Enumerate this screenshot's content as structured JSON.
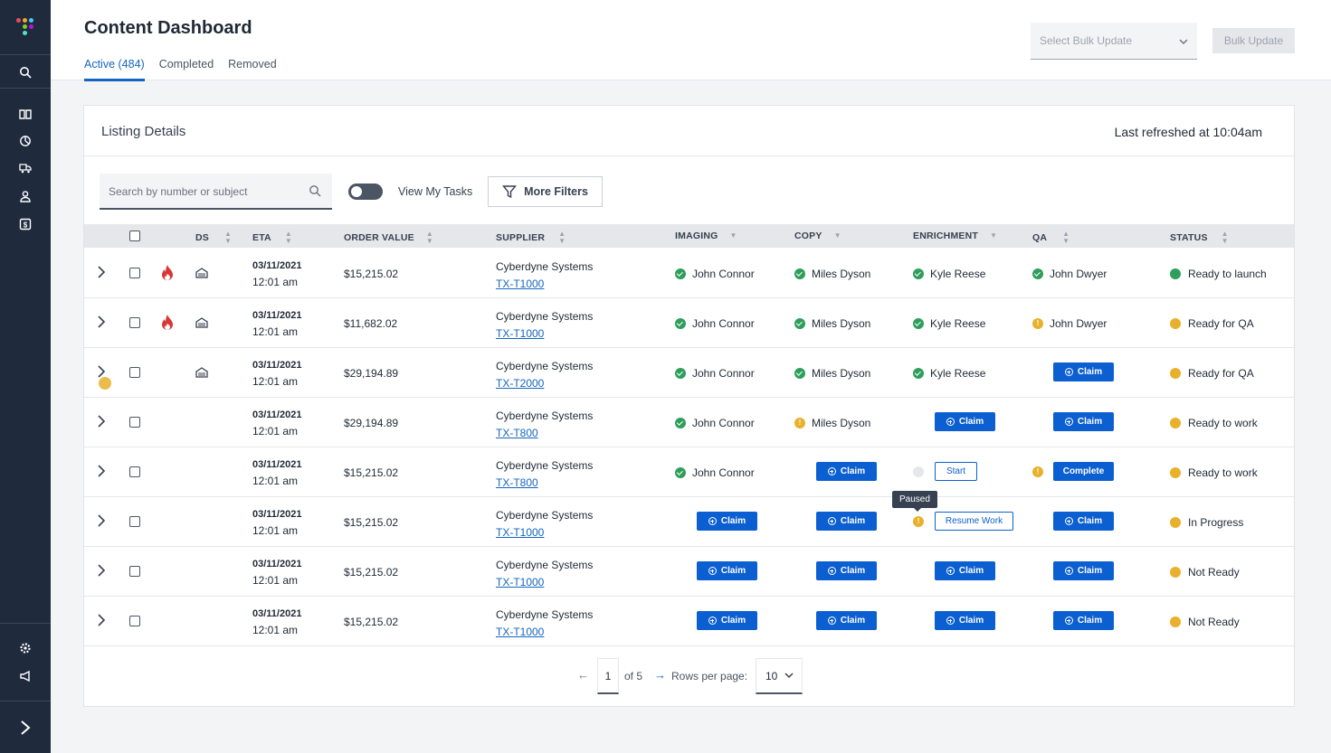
{
  "header": {
    "title": "Content Dashboard",
    "tabs": [
      {
        "label": "Active (484)",
        "active": true
      },
      {
        "label": "Completed",
        "active": false
      },
      {
        "label": "Removed",
        "active": false
      }
    ],
    "bulk_select_placeholder": "Select Bulk Update",
    "bulk_update_label": "Bulk Update"
  },
  "card": {
    "title": "Listing Details",
    "refreshed": "Last refreshed at 10:04am"
  },
  "toolbar": {
    "search_placeholder": "Search by number or subject",
    "toggle_label": "View My Tasks",
    "filters_label": "More Filters"
  },
  "columns": {
    "ds": "DS",
    "eta": "ETA",
    "order_value": "ORDER VALUE",
    "supplier": "SUPPLIER",
    "imaging": "IMAGING",
    "copy": "COPY",
    "enrichment": "ENRICHMENT",
    "qa": "QA",
    "status": "STATUS"
  },
  "labels": {
    "claim": "Claim",
    "start": "Start",
    "resume": "Resume Work",
    "complete": "Complete",
    "paused_tooltip": "Paused"
  },
  "rows": [
    {
      "eta_date": "03/11/2021",
      "eta_time": "12:01 am",
      "value": "$15,215.02",
      "supplier": "Cyberdyne Systems",
      "link": "TX-T1000",
      "imaging": "John Connor",
      "copy": "Miles Dyson",
      "enrichment": "Kyle Reese",
      "qa": "John Dwyer",
      "status": "Ready to launch"
    },
    {
      "eta_date": "03/11/2021",
      "eta_time": "12:01 am",
      "value": "$11,682.02",
      "supplier": "Cyberdyne Systems",
      "link": "TX-T1000",
      "imaging": "John Connor",
      "copy": "Miles Dyson",
      "enrichment": "Kyle Reese",
      "qa": "John Dwyer",
      "status": "Ready for QA"
    },
    {
      "eta_date": "03/11/2021",
      "eta_time": "12:01 am",
      "value": "$29,194.89",
      "supplier": "Cyberdyne Systems",
      "link": "TX-T2000",
      "imaging": "John Connor",
      "copy": "Miles Dyson",
      "enrichment": "Kyle Reese",
      "status": "Ready for QA"
    },
    {
      "eta_date": "03/11/2021",
      "eta_time": "12:01 am",
      "value": "$29,194.89",
      "supplier": "Cyberdyne Systems",
      "link": "TX-T800",
      "imaging": "John Connor",
      "copy": "Miles Dyson",
      "status": "Ready to work"
    },
    {
      "eta_date": "03/11/2021",
      "eta_time": "12:01 am",
      "value": "$15,215.02",
      "supplier": "Cyberdyne Systems",
      "link": "TX-T800",
      "imaging": "John Connor",
      "status": "Ready to work"
    },
    {
      "eta_date": "03/11/2021",
      "eta_time": "12:01 am",
      "value": "$15,215.02",
      "supplier": "Cyberdyne Systems",
      "link": "TX-T1000",
      "status": "In Progress"
    },
    {
      "eta_date": "03/11/2021",
      "eta_time": "12:01 am",
      "value": "$15,215.02",
      "supplier": "Cyberdyne Systems",
      "link": "TX-T1000",
      "status": "Not Ready"
    },
    {
      "eta_date": "03/11/2021",
      "eta_time": "12:01 am",
      "value": "$15,215.02",
      "supplier": "Cyberdyne Systems",
      "link": "TX-T1000",
      "status": "Not Ready"
    }
  ],
  "pagination": {
    "page": "1",
    "of": "of 5",
    "rows_label": "Rows per page:",
    "rows_value": "10"
  },
  "colors": {
    "accent": "#0b5fd0",
    "success": "#2e9e5b",
    "warning": "#e9b02b",
    "sidebar": "#1f2b3d"
  }
}
